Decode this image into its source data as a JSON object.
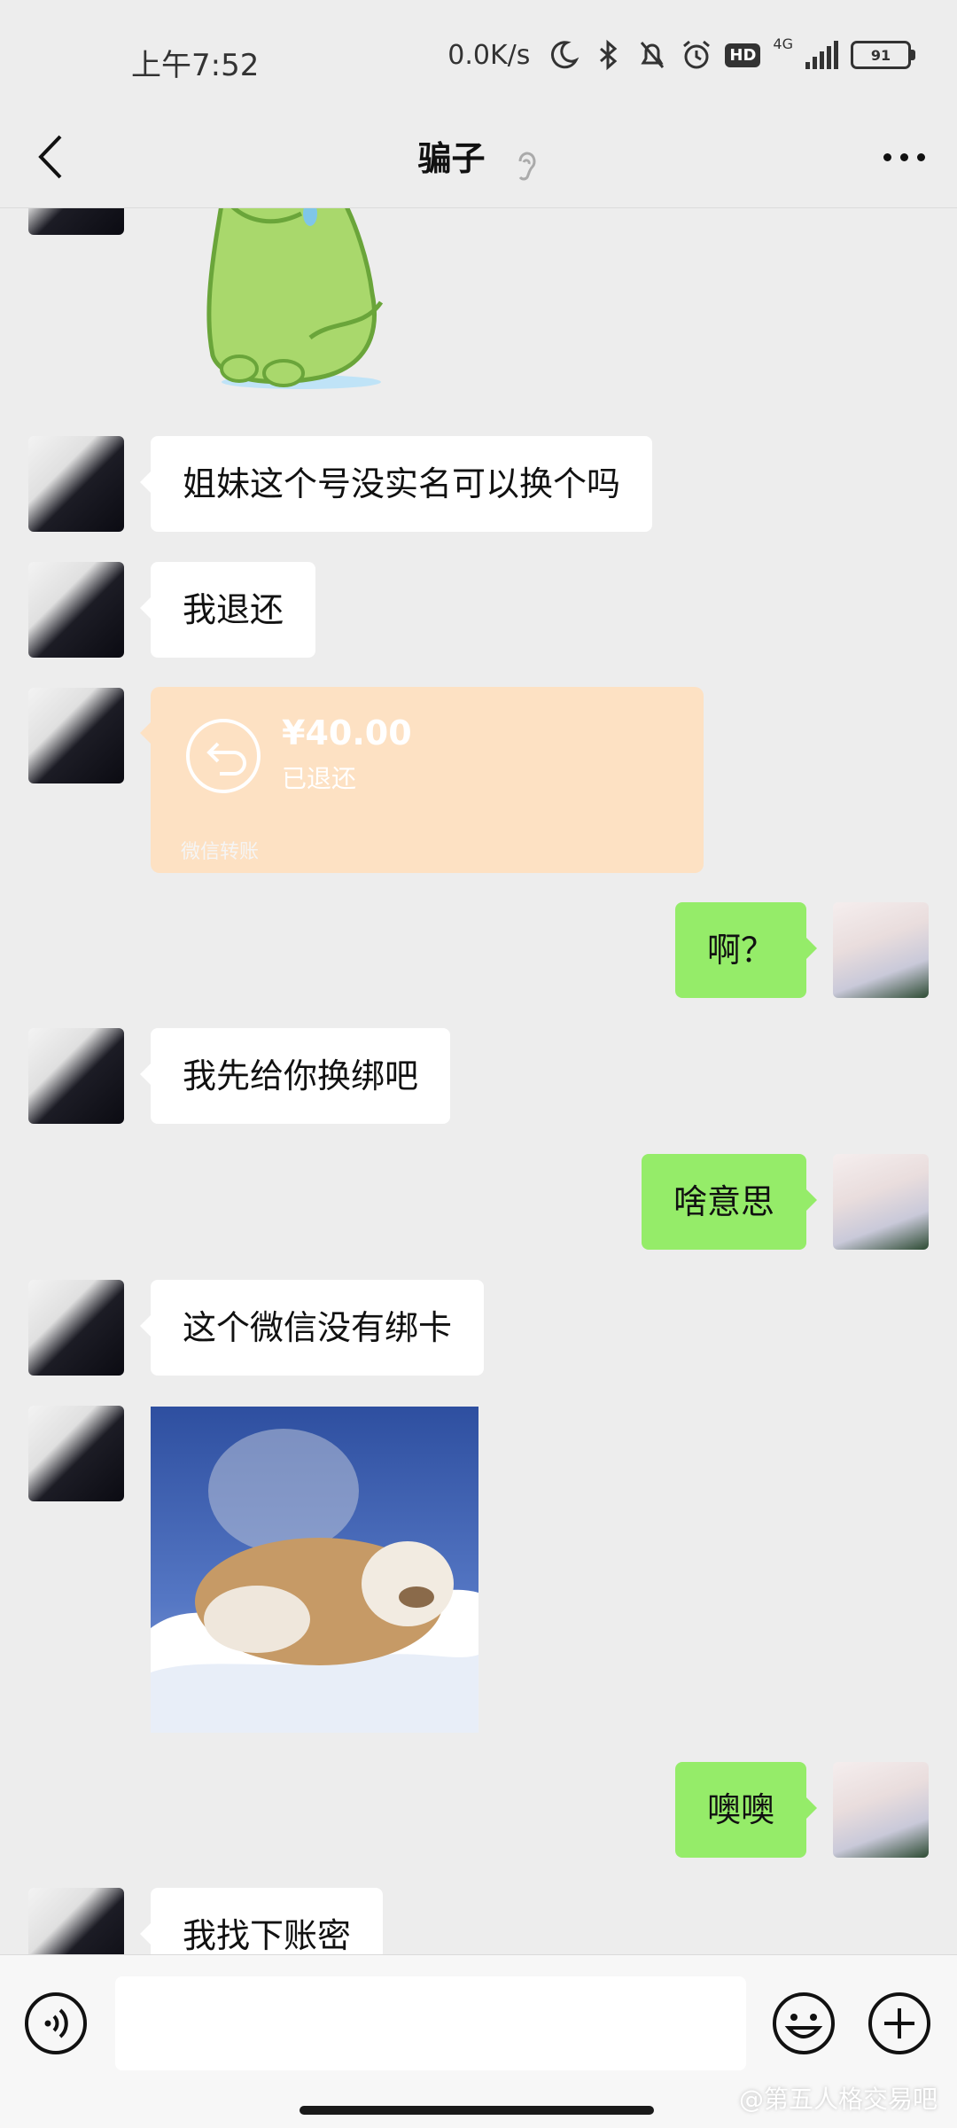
{
  "status_bar": {
    "time": "上午7:52",
    "net_speed": "0.0K/s",
    "network_label": "4G",
    "battery": "91"
  },
  "header": {
    "title": "骗子",
    "icons": [
      "back-chevron-icon",
      "ear-icon",
      "more-icon"
    ]
  },
  "messages": [
    {
      "side": "left",
      "type": "sticker",
      "desc": "sticker"
    },
    {
      "side": "left",
      "type": "text",
      "text": "姐妹这个号没实名可以换个吗"
    },
    {
      "side": "left",
      "type": "text",
      "text": "我退还"
    },
    {
      "side": "left",
      "type": "transfer",
      "amount": "¥40.00",
      "status": "已退还",
      "footer": "微信转账"
    },
    {
      "side": "right",
      "type": "text",
      "text": "啊？"
    },
    {
      "side": "left",
      "type": "text",
      "text": "我先给你换绑吧"
    },
    {
      "side": "right",
      "type": "text",
      "text": "啥意思"
    },
    {
      "side": "left",
      "type": "text",
      "text": "这个微信没有绑卡"
    },
    {
      "side": "left",
      "type": "sticker",
      "desc": "sticker"
    },
    {
      "side": "right",
      "type": "text",
      "text": "噢噢"
    },
    {
      "side": "left",
      "type": "text",
      "text": "我找下账密"
    }
  ],
  "input_bar": {
    "icons": [
      "voice-icon",
      "emoji-icon",
      "plus-icon"
    ]
  },
  "watermark": "@第五人格交易吧",
  "colors": {
    "background": "#ededed",
    "bubble_left": "#ffffff",
    "bubble_right": "#95ec69",
    "transfer": "#fde1c3"
  }
}
